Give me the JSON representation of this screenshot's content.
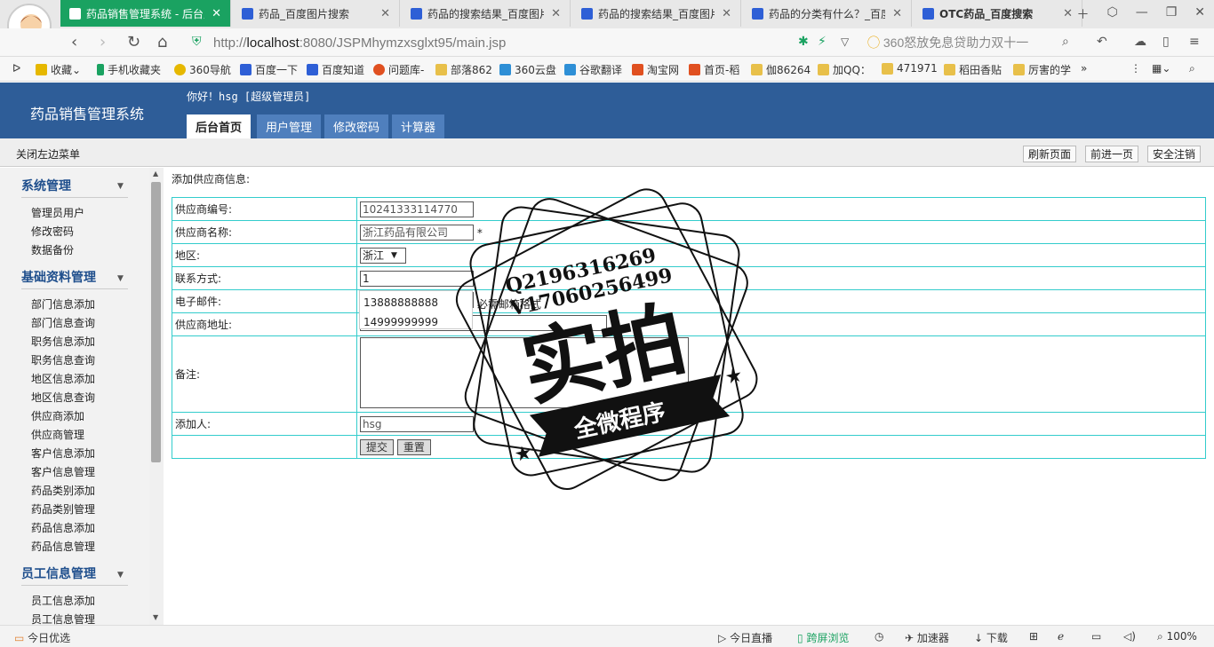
{
  "browser": {
    "tabs": [
      {
        "title": "药品销售管理系统 - 后台主",
        "active": true
      },
      {
        "title": "药品_百度图片搜索",
        "active": false
      },
      {
        "title": "药品的搜索结果_百度图片",
        "active": false
      },
      {
        "title": "药品的搜索结果_百度图片",
        "active": false
      },
      {
        "title": "药品的分类有什么？_百度",
        "active": false
      },
      {
        "title": "OTC药品_百度搜索",
        "active": false
      }
    ],
    "url_prefix": "http://",
    "url_host": "localhost",
    "url_rest": ":8080/JSPMhymzxsglxt95/main.jsp",
    "search_placeholder": "360怒放免息贷助力双十一",
    "bookmarks": [
      "收藏",
      "手机收藏夹",
      "360导航",
      "百度一下",
      "百度知道",
      "问题库-",
      "部落862",
      "360云盘",
      "谷歌翻译",
      "淘宝网",
      "首页-稻",
      "伽86264",
      "加QQ：",
      "471971",
      "稻田香贴",
      "厉害的学"
    ],
    "status_left": "今日优选",
    "status_items": [
      "今日直播",
      "跨屏浏览",
      "加速器",
      "下载"
    ],
    "zoom": "100%"
  },
  "header": {
    "system_name": "药品销售管理系统",
    "greeting": "你好！hsg [超级管理员]",
    "nav": [
      "后台首页",
      "用户管理",
      "修改密码",
      "计算器"
    ],
    "nav_active_index": 0
  },
  "subbar": {
    "close_left": "关闭左边菜单",
    "buttons": [
      "刷新页面",
      "前进一页",
      "安全注销"
    ]
  },
  "sidebar": {
    "groups": [
      {
        "title": "系统管理",
        "items": [
          "管理员用户",
          "修改密码",
          "数据备份"
        ]
      },
      {
        "title": "基础资料管理",
        "items": [
          "部门信息添加",
          "部门信息查询",
          "职务信息添加",
          "职务信息查询",
          "地区信息添加",
          "地区信息查询",
          "供应商添加",
          "供应商管理",
          "客户信息添加",
          "客户信息管理",
          "药品类别添加",
          "药品类别管理",
          "药品信息添加",
          "药品信息管理"
        ]
      },
      {
        "title": "员工信息管理",
        "items": [
          "员工信息添加",
          "员工信息管理"
        ]
      }
    ]
  },
  "form": {
    "title": "添加供应商信息:",
    "fields": {
      "supplier_no": {
        "label": "供应商编号:",
        "value": "10241333114770"
      },
      "supplier_name": {
        "label": "供应商名称:",
        "value": "浙江药品有限公司",
        "required_mark": "*"
      },
      "region": {
        "label": "地区:",
        "value": "浙江"
      },
      "contact": {
        "label": "联系方式:",
        "value": "1"
      },
      "email": {
        "label": "电子邮件:",
        "hint": "必需邮箱格式"
      },
      "address": {
        "label": "供应商地址:"
      },
      "remark": {
        "label": "备注:"
      },
      "adder": {
        "label": "添加人:",
        "value": "hsg"
      }
    },
    "submit_label": "提交",
    "reset_label": "重置",
    "autocomplete": [
      "13888888888",
      "14999999999"
    ]
  },
  "watermark": {
    "line1": "Q2196316269",
    "line2": "V17060256499",
    "big": "实拍",
    "ribbon": "全微程序"
  }
}
